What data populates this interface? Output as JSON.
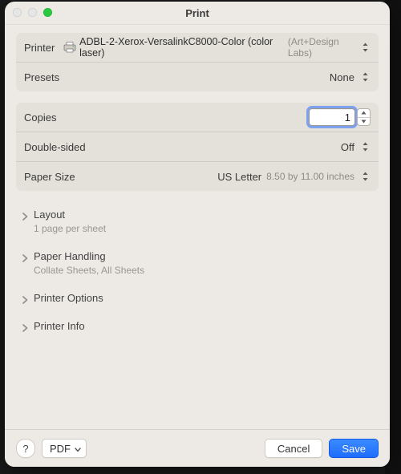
{
  "window": {
    "title": "Print"
  },
  "printer": {
    "label": "Printer",
    "name": "ADBL-2-Xerox-VersalinkC8000-Color (color laser)",
    "location": "(Art+Design Labs)"
  },
  "presets": {
    "label": "Presets",
    "value": "None"
  },
  "copies": {
    "label": "Copies",
    "value": "1"
  },
  "double_sided": {
    "label": "Double-sided",
    "value": "Off"
  },
  "paper_size": {
    "label": "Paper Size",
    "value": "US Letter",
    "detail": "8.50 by 11.00 inches"
  },
  "sections": {
    "layout": {
      "title": "Layout",
      "subtitle": "1 page per sheet"
    },
    "paper_handling": {
      "title": "Paper Handling",
      "subtitle": "Collate Sheets, All Sheets"
    },
    "printer_options": {
      "title": "Printer Options"
    },
    "printer_info": {
      "title": "Printer Info"
    }
  },
  "footer": {
    "help": "?",
    "pdf": "PDF",
    "cancel": "Cancel",
    "save": "Save"
  }
}
